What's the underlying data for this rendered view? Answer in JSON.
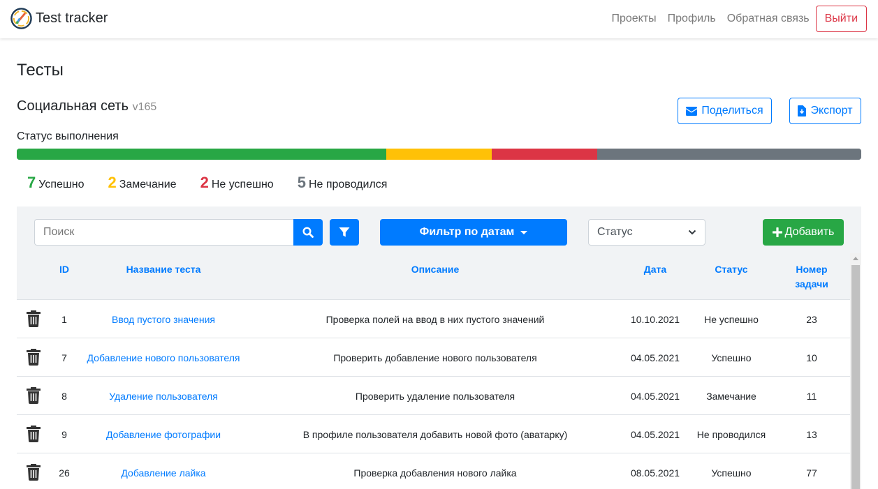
{
  "navbar": {
    "brand": "Test tracker",
    "links": [
      "Проекты",
      "Профиль",
      "Обратная связь"
    ],
    "logout_label": "Выйти"
  },
  "page": {
    "title": "Тесты",
    "project_name": "Социальная сеть",
    "project_version": "v165",
    "share_label": "Поделиться",
    "export_label": "Экспорт"
  },
  "progress": {
    "label": "Статус выполнения",
    "segments": [
      {
        "status": "Успешно",
        "count": 7,
        "color": "#28a745"
      },
      {
        "status": "Замечание",
        "count": 2,
        "color": "#ffc107"
      },
      {
        "status": "Не успешно",
        "count": 2,
        "color": "#dc3545"
      },
      {
        "status": "Не проводился",
        "count": 5,
        "color": "#6c757d"
      }
    ]
  },
  "stats": [
    {
      "value": "7",
      "label": "Успешно",
      "color": "#28a745"
    },
    {
      "value": "2",
      "label": "Замечание",
      "color": "#ffc107"
    },
    {
      "value": "2",
      "label": "Не успешно",
      "color": "#dc3545"
    },
    {
      "value": "5",
      "label": "Не проводился",
      "color": "#6c757d"
    }
  ],
  "filters": {
    "search_placeholder": "Поиск",
    "search_icon": "search-icon",
    "filter_icon": "filter-icon",
    "date_filter_label": "Фильтр по датам",
    "status_select_value": "Статус",
    "add_label": "Добавить"
  },
  "table": {
    "headers": {
      "id": "ID",
      "name": "Название теста",
      "description": "Описание",
      "date": "Дата",
      "status": "Статус",
      "task_line1": "Номер",
      "task_line2": "задачи"
    },
    "rows": [
      {
        "id": "1",
        "name": "Ввод пустого значения",
        "description": "Проверка полей на ввод в них пустого значений",
        "date": "10.10.2021",
        "status": "Не успешно",
        "task": "23"
      },
      {
        "id": "7",
        "name": "Добавление нового пользователя",
        "description": "Проверить добавление нового пользователя",
        "date": "04.05.2021",
        "status": "Успешно",
        "task": "10"
      },
      {
        "id": "8",
        "name": "Удаление пользователя",
        "description": "Проверить удаление пользователя",
        "date": "04.05.2021",
        "status": "Замечание",
        "task": "11"
      },
      {
        "id": "9",
        "name": "Добавление фотографии",
        "description": "В профиле пользователя добавить новой фото (аватарку)",
        "date": "04.05.2021",
        "status": "Не проводился",
        "task": "13"
      },
      {
        "id": "26",
        "name": "Добавление лайка",
        "description": "Проверка добавления нового лайка",
        "date": "08.05.2021",
        "status": "Успешно",
        "task": "77"
      }
    ]
  },
  "colors": {
    "primary": "#007bff",
    "success": "#28a745",
    "warning": "#ffc107",
    "danger": "#dc3545",
    "secondary": "#6c757d"
  }
}
